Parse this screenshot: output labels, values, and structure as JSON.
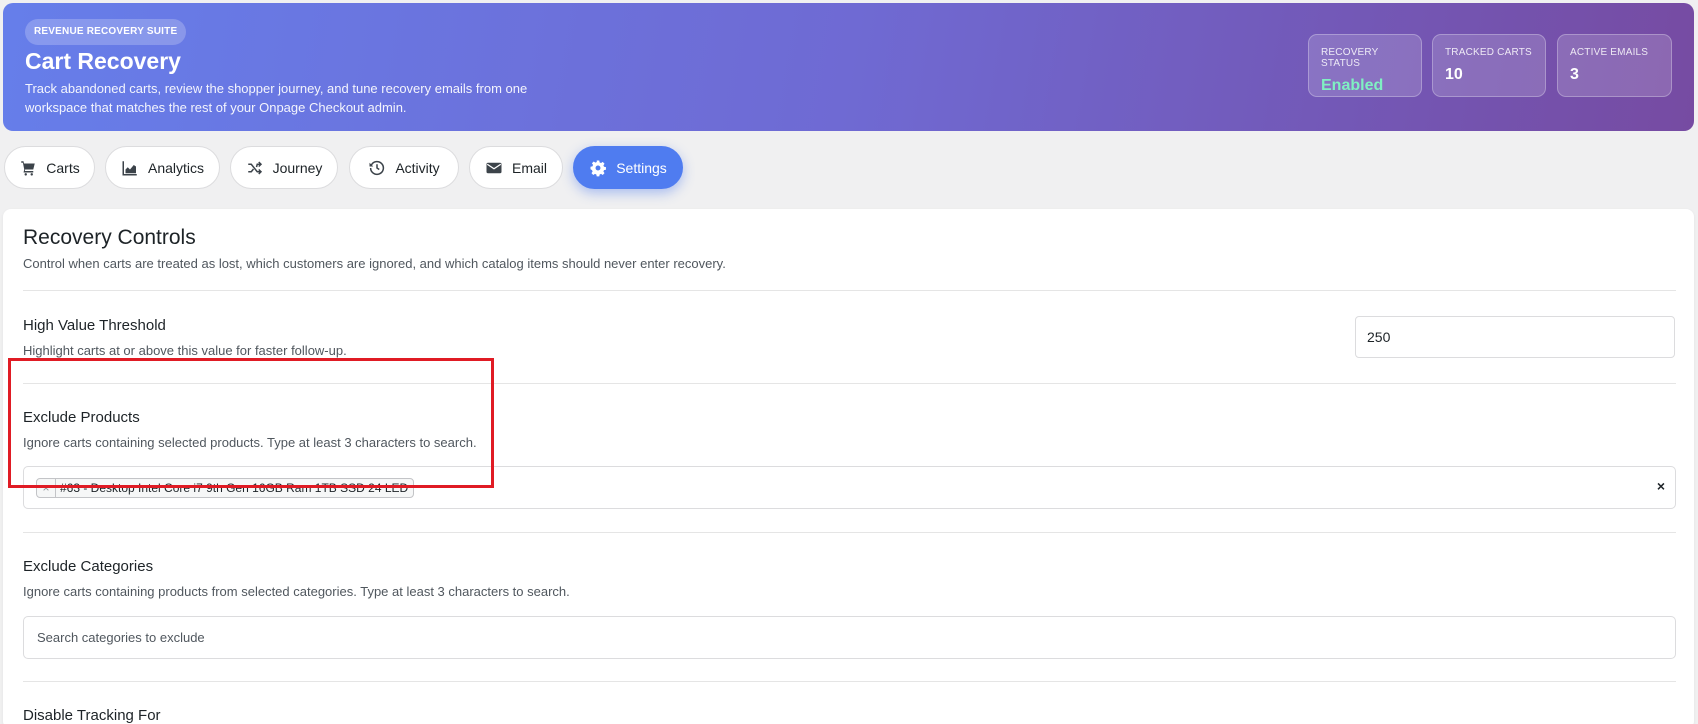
{
  "header": {
    "badge": "REVENUE RECOVERY SUITE",
    "title": "Cart Recovery",
    "subtitle": "Track abandoned carts, review the shopper journey, and tune recovery emails from one workspace that matches the rest of your Onpage Checkout admin.",
    "stats": [
      {
        "label": "RECOVERY STATUS",
        "value": "Enabled"
      },
      {
        "label": "TRACKED CARTS",
        "value": "10"
      },
      {
        "label": "ACTIVE EMAILS",
        "value": "3"
      }
    ]
  },
  "tabs": [
    {
      "label": "Carts",
      "icon": "cart-icon"
    },
    {
      "label": "Analytics",
      "icon": "chart-icon"
    },
    {
      "label": "Journey",
      "icon": "shuffle-icon"
    },
    {
      "label": "Activity",
      "icon": "history-icon"
    },
    {
      "label": "Email",
      "icon": "envelope-icon"
    },
    {
      "label": "Settings",
      "icon": "gear-icon",
      "active": true
    }
  ],
  "panel": {
    "title": "Recovery Controls",
    "subtitle": "Control when carts are treated as lost, which customers are ignored, and which catalog items should never enter recovery.",
    "high_value": {
      "title": "High Value Threshold",
      "description": "Highlight carts at or above this value for faster follow-up.",
      "value": "250"
    },
    "exclude_products": {
      "title": "Exclude Products",
      "description": "Ignore carts containing selected products. Type at least 3 characters to search.",
      "chips": [
        {
          "remove": "×",
          "label": "#63 - Desktop Intel Core i7 9th Gen 16GB Ram 1TB SSD 24 LED"
        }
      ],
      "clear": "×"
    },
    "exclude_categories": {
      "title": "Exclude Categories",
      "description": "Ignore carts containing products from selected categories. Type at least 3 characters to search.",
      "placeholder": "Search categories to exclude"
    },
    "disable_tracking": {
      "title": "Disable Tracking For"
    }
  },
  "colors": {
    "header_gradient_start": "#667eea",
    "header_gradient_end": "#764ba2",
    "active_tab": "#4f7cf0",
    "status_enabled": "#7ff0c2",
    "highlight": "#e01b24"
  }
}
